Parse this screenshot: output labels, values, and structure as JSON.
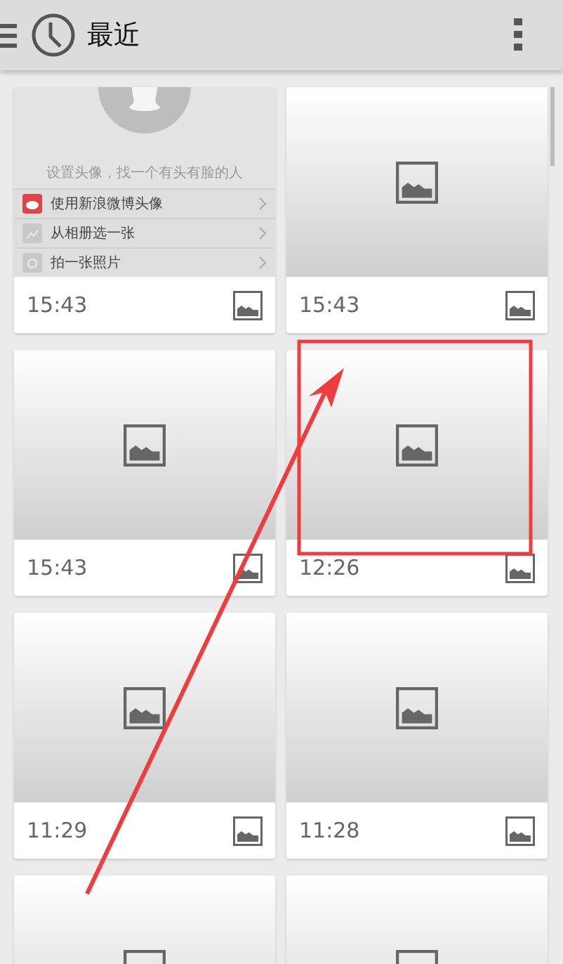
{
  "app_bar": {
    "title": "最近"
  },
  "cards": [
    {
      "kind": "screenshot",
      "time": "15:43",
      "screenshot": {
        "caption": "设置头像，找一个有头有脸的人",
        "options": [
          {
            "kind": "weibo",
            "label": "使用新浪微博头像"
          },
          {
            "kind": "album",
            "label": "从相册选一张"
          },
          {
            "kind": "camera",
            "label": "拍一张照片"
          }
        ]
      }
    },
    {
      "kind": "placeholder",
      "time": "15:43"
    },
    {
      "kind": "placeholder",
      "time": "15:43"
    },
    {
      "kind": "placeholder",
      "time": "12:26"
    },
    {
      "kind": "placeholder",
      "time": "11:29"
    },
    {
      "kind": "placeholder",
      "time": "11:28"
    },
    {
      "kind": "placeholder"
    },
    {
      "kind": "placeholder"
    }
  ]
}
